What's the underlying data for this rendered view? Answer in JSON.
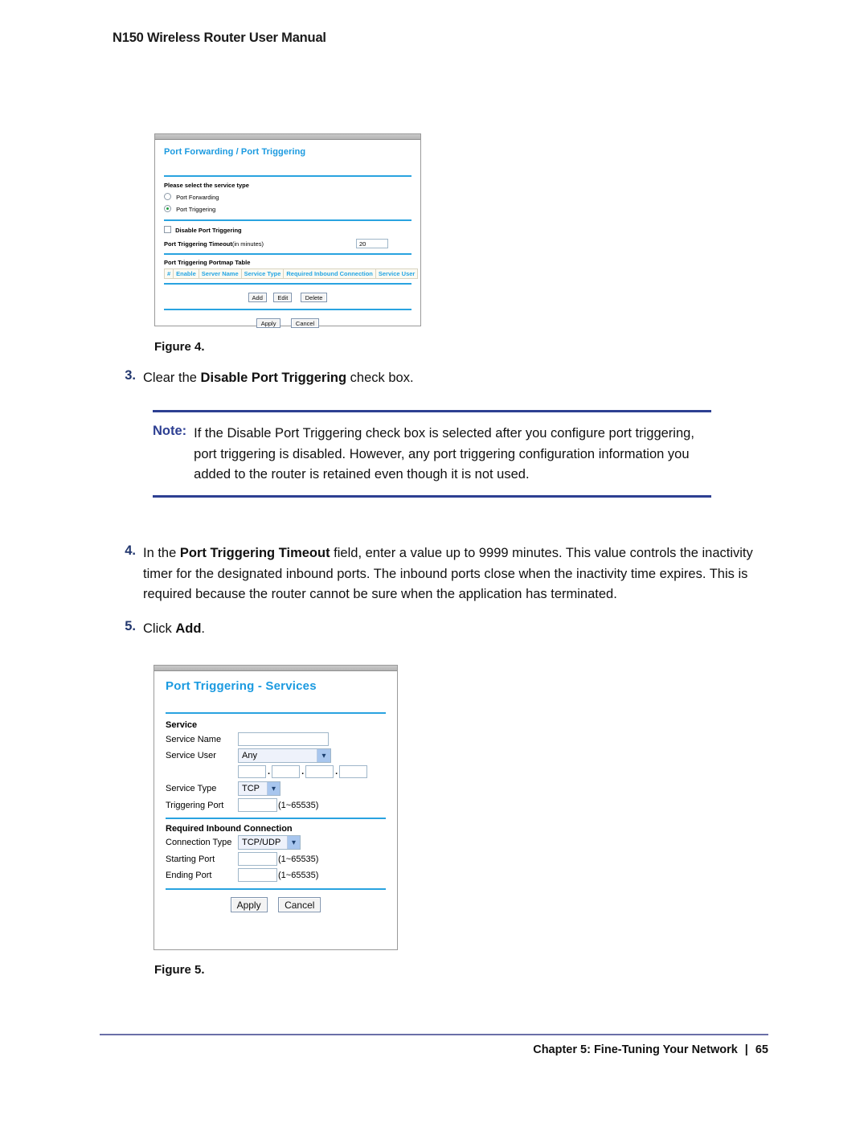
{
  "header": {
    "running_title": "N150 Wireless Router User Manual"
  },
  "figure1": {
    "title": "Port Forwarding / Port Triggering",
    "service_type_prompt": "Please select the service type",
    "radio_port_forwarding": "Port Forwarding",
    "radio_port_triggering": "Port Triggering",
    "checkbox_disable": "Disable Port Triggering",
    "timeout_label_bold": "Port Triggering Timeout",
    "timeout_label_rest": " (in minutes)",
    "timeout_value": "20",
    "portmap_table_label": "Port Triggering Portmap Table",
    "table_headers": [
      "#",
      "Enable",
      "Server Name",
      "Service Type",
      "Required Inbound Connection",
      "Service User"
    ],
    "btn_add": "Add",
    "btn_edit": "Edit",
    "btn_delete": "Delete",
    "btn_apply": "Apply",
    "btn_cancel": "Cancel",
    "caption": "Figure 4."
  },
  "steps": {
    "step3": {
      "num": "3.",
      "text_a": "Clear the ",
      "text_b": "Disable Port Triggering",
      "text_c": " check box."
    },
    "step4": {
      "num": "4.",
      "text_a": "In the ",
      "text_b": "Port Triggering Timeout",
      "text_c": " field, enter a value up to 9999 minutes. This value controls the inactivity timer for the designated inbound ports. The inbound ports close when the inactivity time expires. This is required because the router cannot be sure when the application has terminated."
    },
    "step5": {
      "num": "5.",
      "text_a": "Click ",
      "text_b": "Add",
      "text_c": "."
    }
  },
  "note": {
    "label": "Note:",
    "text": "If the Disable Port Triggering check box is selected after you configure port triggering, port triggering is disabled. However, any port triggering configuration information you added to the router is retained even though it is not used."
  },
  "figure2": {
    "title": "Port Triggering - Services",
    "section_service": "Service",
    "label_service_name": "Service Name",
    "value_service_name": "",
    "label_service_user": "Service User",
    "value_service_user": "Any",
    "ip_octets": [
      "",
      "",
      "",
      ""
    ],
    "ip_dot": ".",
    "label_service_type": "Service Type",
    "value_service_type": "TCP",
    "label_triggering_port": "Triggering Port",
    "value_triggering_port": "",
    "hint_triggering_port": "(1~65535)",
    "section_inbound": "Required Inbound Connection",
    "label_connection_type": "Connection Type",
    "value_connection_type": "TCP/UDP",
    "label_starting_port": "Starting Port",
    "value_starting_port": "",
    "hint_starting_port": "(1~65535)",
    "label_ending_port": "Ending Port",
    "value_ending_port": "",
    "hint_ending_port": "(1~65535)",
    "btn_apply": "Apply",
    "btn_cancel": "Cancel",
    "caption": "Figure 5."
  },
  "footer": {
    "chapter": "Chapter 5:  Fine-Tuning Your Network",
    "separator": "|",
    "page_number": "65"
  },
  "icons": {
    "dropdown_arrow": "⌄"
  },
  "colors": {
    "ui_title_blue": "#1b9ae0",
    "ui_rule_cyan": "#29a3e0",
    "step_number_navy": "#22376e",
    "note_navy": "#2d3f92",
    "footer_rule": "#6a6fa8",
    "table_header_text": "#25a6e4",
    "radio_selected_green": "#1f9c3f"
  }
}
